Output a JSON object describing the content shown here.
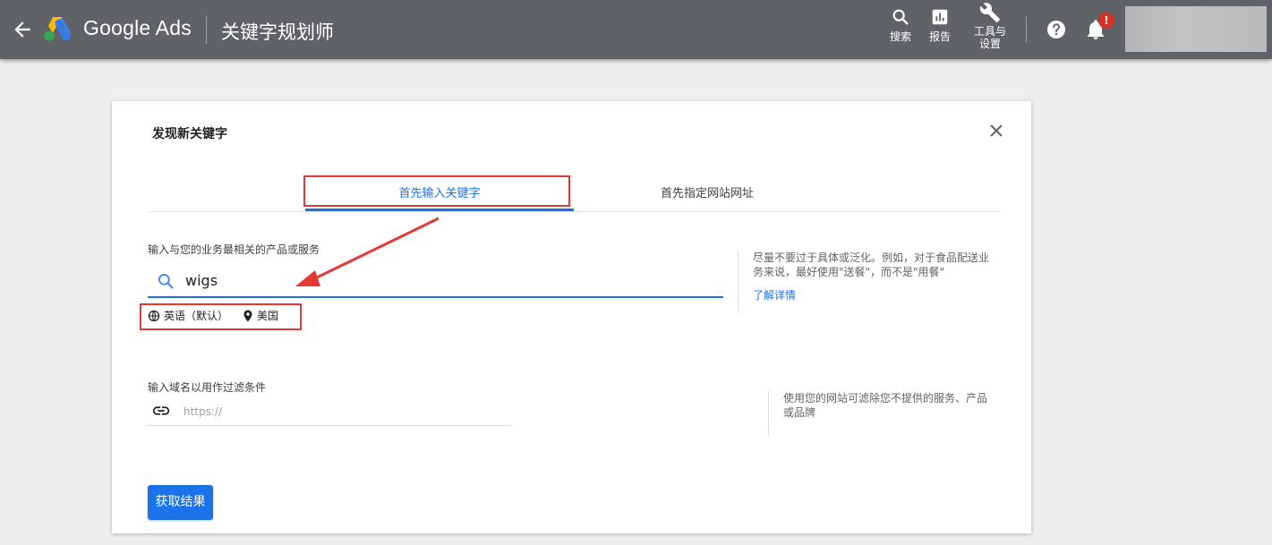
{
  "header": {
    "brand": "Google Ads",
    "page_title": "关键字规划师",
    "actions": {
      "search": "搜索",
      "reports": "报告",
      "tools_line1": "工具与",
      "tools_line2": "设置"
    },
    "notification_badge": "!"
  },
  "dialog": {
    "title": "发现新关键字",
    "tabs": [
      {
        "label": "首先输入关键字",
        "active": true
      },
      {
        "label": "首先指定网站网址",
        "active": false
      }
    ],
    "keyword_section": {
      "label": "输入与您的业务最相关的产品或服务",
      "value": "wigs",
      "language": "英语（默认）",
      "location": "美国",
      "tip": "尽量不要过于具体或泛化。例如，对于食品配送业务来说，最好使用\"送餐\"，而不是\"用餐\"",
      "tip_link": "了解详情"
    },
    "domain_section": {
      "label": "输入域名以用作过滤条件",
      "placeholder": "https://",
      "tip": "使用您的网站可滤除您不提供的服务、产品或品牌"
    },
    "submit_label": "获取结果"
  },
  "colors": {
    "topbar": "#5f6368",
    "accent": "#1a73e8",
    "annotation": "#e53935"
  }
}
